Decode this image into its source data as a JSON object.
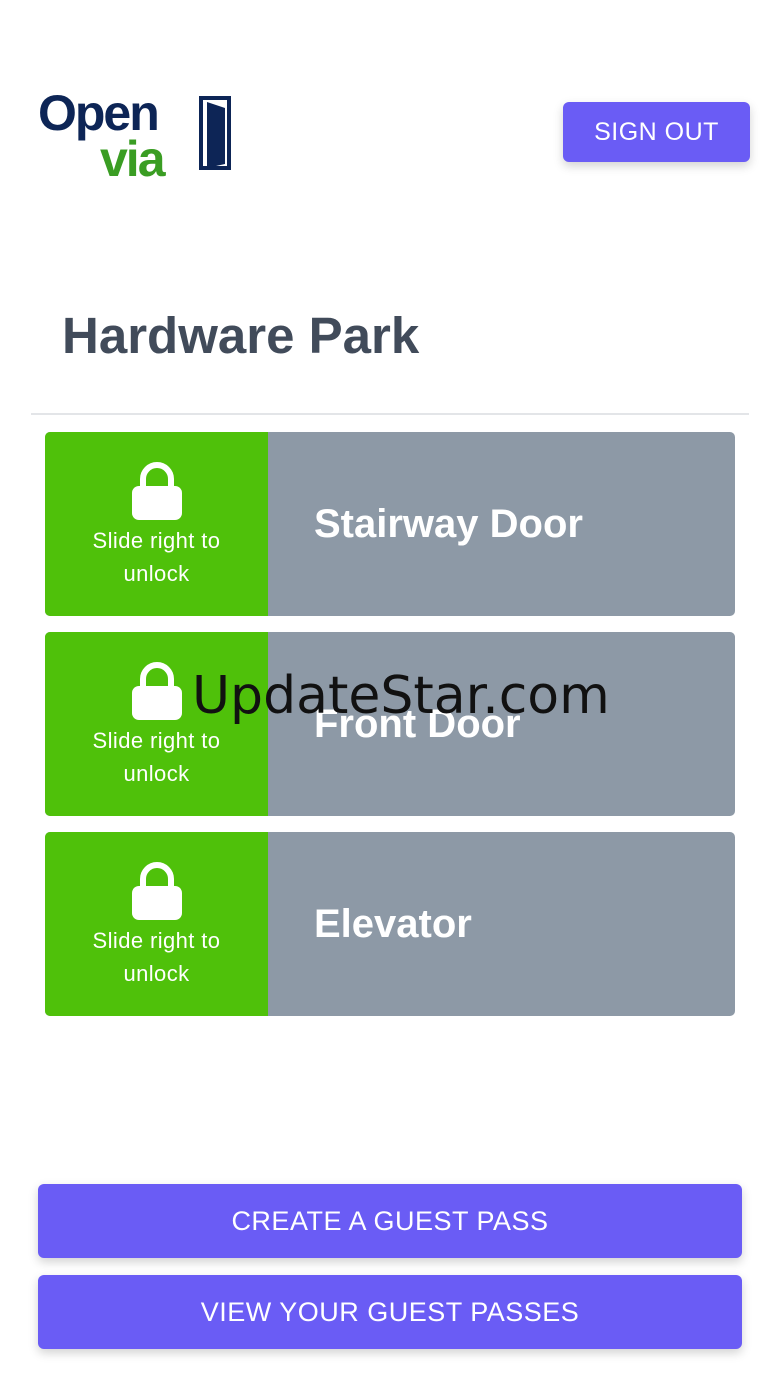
{
  "brand": {
    "logo_line1": "Open",
    "logo_line2": "via",
    "name_color": "#0d2556",
    "via_color": "#3a9d23"
  },
  "header": {
    "sign_out_label": "SIGN OUT"
  },
  "site": {
    "title": "Hardware Park"
  },
  "doors": [
    {
      "name": "Stairway Door",
      "slider_label": "Slide right to unlock",
      "icon": "lock-icon"
    },
    {
      "name": "Front Door",
      "slider_label": "Slide right to unlock",
      "icon": "lock-icon"
    },
    {
      "name": "Elevator",
      "slider_label": "Slide right to unlock",
      "icon": "lock-icon"
    }
  ],
  "watermark": "UpdateStar.com",
  "actions": {
    "create_guest_pass": "CREATE A GUEST PASS",
    "view_guest_passes": "VIEW YOUR GUEST PASSES"
  },
  "colors": {
    "accent": "#6a5cf5",
    "slider_green": "#4fc10a",
    "door_gray": "#8d99a6",
    "title_text": "#414b5a"
  }
}
